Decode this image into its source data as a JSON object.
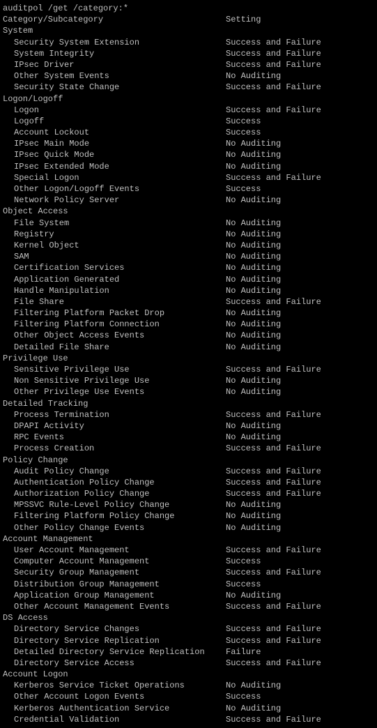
{
  "header": {
    "line1": "auditpol /get /category:*",
    "col_category": "Category/Subcategory",
    "col_setting": "Setting"
  },
  "sections": [
    {
      "name": "System",
      "items": [
        {
          "name": "Security System Extension",
          "setting": "Success and Failure"
        },
        {
          "name": "System Integrity",
          "setting": "Success and Failure"
        },
        {
          "name": "IPsec Driver",
          "setting": "Success and Failure"
        },
        {
          "name": "Other System Events",
          "setting": "No Auditing"
        },
        {
          "name": "Security State Change",
          "setting": "Success and Failure"
        }
      ]
    },
    {
      "name": "Logon/Logoff",
      "items": [
        {
          "name": "Logon",
          "setting": "Success and Failure"
        },
        {
          "name": "Logoff",
          "setting": "Success"
        },
        {
          "name": "Account Lockout",
          "setting": "Success"
        },
        {
          "name": "IPsec Main Mode",
          "setting": "No Auditing"
        },
        {
          "name": "IPsec Quick Mode",
          "setting": "No Auditing"
        },
        {
          "name": "IPsec Extended Mode",
          "setting": "No Auditing"
        },
        {
          "name": "Special Logon",
          "setting": "Success and Failure"
        },
        {
          "name": "Other Logon/Logoff Events",
          "setting": "Success"
        },
        {
          "name": "Network Policy Server",
          "setting": "No Auditing"
        }
      ]
    },
    {
      "name": "Object Access",
      "items": [
        {
          "name": "File System",
          "setting": "No Auditing"
        },
        {
          "name": "Registry",
          "setting": "No Auditing"
        },
        {
          "name": "Kernel Object",
          "setting": "No Auditing"
        },
        {
          "name": "SAM",
          "setting": "No Auditing"
        },
        {
          "name": "Certification Services",
          "setting": "No Auditing"
        },
        {
          "name": "Application Generated",
          "setting": "No Auditing"
        },
        {
          "name": "Handle Manipulation",
          "setting": "No Auditing"
        },
        {
          "name": "File Share",
          "setting": "Success and Failure"
        },
        {
          "name": "Filtering Platform Packet Drop",
          "setting": "No Auditing"
        },
        {
          "name": "Filtering Platform Connection",
          "setting": "No Auditing"
        },
        {
          "name": "Other Object Access Events",
          "setting": "No Auditing"
        },
        {
          "name": "Detailed File Share",
          "setting": "No Auditing"
        }
      ]
    },
    {
      "name": "Privilege Use",
      "items": [
        {
          "name": "Sensitive Privilege Use",
          "setting": "Success and Failure"
        },
        {
          "name": "Non Sensitive Privilege Use",
          "setting": "No Auditing"
        },
        {
          "name": "Other Privilege Use Events",
          "setting": "No Auditing"
        }
      ]
    },
    {
      "name": "Detailed Tracking",
      "items": [
        {
          "name": "Process Termination",
          "setting": "Success and Failure"
        },
        {
          "name": "DPAPI Activity",
          "setting": "No Auditing"
        },
        {
          "name": "RPC Events",
          "setting": "No Auditing"
        },
        {
          "name": "Process Creation",
          "setting": "Success and Failure"
        }
      ]
    },
    {
      "name": "Policy Change",
      "items": [
        {
          "name": "Audit Policy Change",
          "setting": "Success and Failure"
        },
        {
          "name": "Authentication Policy Change",
          "setting": "Success and Failure"
        },
        {
          "name": "Authorization Policy Change",
          "setting": "Success and Failure"
        },
        {
          "name": "MPSSVC Rule-Level Policy Change",
          "setting": "No Auditing"
        },
        {
          "name": "Filtering Platform Policy Change",
          "setting": "No Auditing"
        },
        {
          "name": "Other Policy Change Events",
          "setting": "No Auditing"
        }
      ]
    },
    {
      "name": "Account Management",
      "items": [
        {
          "name": "User Account Management",
          "setting": "Success and Failure"
        },
        {
          "name": "Computer Account Management",
          "setting": "Success"
        },
        {
          "name": "Security Group Management",
          "setting": "Success and Failure"
        },
        {
          "name": "Distribution Group Management",
          "setting": "Success"
        },
        {
          "name": "Application Group Management",
          "setting": "No Auditing"
        },
        {
          "name": "Other Account Management Events",
          "setting": "Success and Failure"
        }
      ]
    },
    {
      "name": "DS Access",
      "items": [
        {
          "name": "Directory Service Changes",
          "setting": "Success and Failure"
        },
        {
          "name": "Directory Service Replication",
          "setting": "Success and Failure"
        },
        {
          "name": "Detailed Directory Service Replication",
          "setting": "Failure"
        },
        {
          "name": "Directory Service Access",
          "setting": "Success and Failure"
        }
      ]
    },
    {
      "name": "Account Logon",
      "items": [
        {
          "name": "Kerberos Service Ticket Operations",
          "setting": "No Auditing"
        },
        {
          "name": "Other Account Logon Events",
          "setting": "Success"
        },
        {
          "name": "Kerberos Authentication Service",
          "setting": "No Auditing"
        },
        {
          "name": "Credential Validation",
          "setting": "Success and Failure"
        }
      ]
    }
  ]
}
